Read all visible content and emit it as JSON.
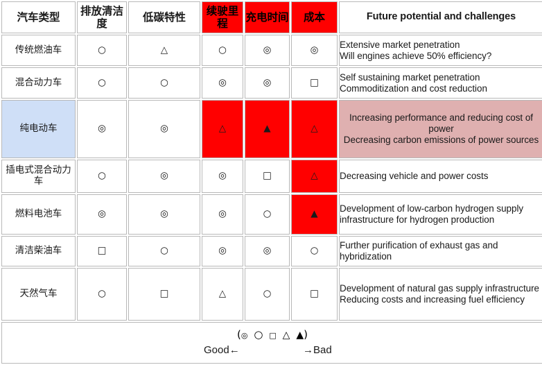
{
  "table": {
    "headers": [
      {
        "label": "汽车类型",
        "style": "blue",
        "cjk": true
      },
      {
        "label": "排放清洁度",
        "style": "blue",
        "cjk": true
      },
      {
        "label": "低碳特性",
        "style": "blue",
        "cjk": true
      },
      {
        "label": "续驶里程",
        "style": "red",
        "cjk": true
      },
      {
        "label": "充电时间",
        "style": "red",
        "cjk": true
      },
      {
        "label": "成本",
        "style": "red",
        "cjk": true
      },
      {
        "label": "Future potential and challenges",
        "style": "blue",
        "cjk": false
      }
    ],
    "rows": [
      {
        "type": "传统燃油车",
        "type_highlight": false,
        "cells": [
          {
            "symbol": "○",
            "glyph": "circle",
            "red": false
          },
          {
            "symbol": "△",
            "glyph": "triangle",
            "red": false
          },
          {
            "symbol": "○",
            "glyph": "circle",
            "red": false
          },
          {
            "symbol": "◎",
            "glyph": "double-circle",
            "red": false
          },
          {
            "symbol": "◎",
            "glyph": "double-circle",
            "red": false
          }
        ],
        "notes": [
          "Extensive market penetration",
          "Will engines achieve 50% efficiency?"
        ],
        "notes_pink": false
      },
      {
        "type": "混合动力车",
        "type_highlight": false,
        "cells": [
          {
            "symbol": "○",
            "glyph": "circle",
            "red": false
          },
          {
            "symbol": "○",
            "glyph": "circle",
            "red": false
          },
          {
            "symbol": "◎",
            "glyph": "double-circle",
            "red": false
          },
          {
            "symbol": "◎",
            "glyph": "double-circle",
            "red": false
          },
          {
            "symbol": "□",
            "glyph": "square",
            "red": false
          }
        ],
        "notes": [
          "Self sustaining market penetration",
          "Commoditization and cost reduction"
        ],
        "notes_pink": false
      },
      {
        "type": "纯电动车",
        "type_highlight": true,
        "cells": [
          {
            "symbol": "◎",
            "glyph": "double-circle",
            "red": false
          },
          {
            "symbol": "◎",
            "glyph": "double-circle",
            "red": false
          },
          {
            "symbol": "△",
            "glyph": "triangle",
            "red": true
          },
          {
            "symbol": "▲",
            "glyph": "filled-triangle",
            "red": true
          },
          {
            "symbol": "△",
            "glyph": "triangle",
            "red": true
          }
        ],
        "notes": [
          "Increasing performance and reducing cost of power",
          "Decreasing carbon emissions of power sources"
        ],
        "notes_pink": true
      },
      {
        "type": "插电式混合动力车",
        "type_highlight": false,
        "cells": [
          {
            "symbol": "○",
            "glyph": "circle",
            "red": false
          },
          {
            "symbol": "◎",
            "glyph": "double-circle",
            "red": false
          },
          {
            "symbol": "◎",
            "glyph": "double-circle",
            "red": false
          },
          {
            "symbol": "□",
            "glyph": "square",
            "red": false
          },
          {
            "symbol": "△",
            "glyph": "triangle",
            "red": true
          }
        ],
        "notes": [
          "Decreasing vehicle and power costs"
        ],
        "notes_pink": false
      },
      {
        "type": "燃料电池车",
        "type_highlight": false,
        "cells": [
          {
            "symbol": "◎",
            "glyph": "double-circle",
            "red": false
          },
          {
            "symbol": "◎",
            "glyph": "double-circle",
            "red": false
          },
          {
            "symbol": "◎",
            "glyph": "double-circle",
            "red": false
          },
          {
            "symbol": "○",
            "glyph": "circle",
            "red": false
          },
          {
            "symbol": "▲",
            "glyph": "filled-triangle",
            "red": true
          }
        ],
        "notes": [
          "Development of low-carbon hydrogen supply infrastructure for hydrogen production"
        ],
        "notes_pink": false
      },
      {
        "type": "清洁柴油车",
        "type_highlight": false,
        "cells": [
          {
            "symbol": "□",
            "glyph": "square",
            "red": false
          },
          {
            "symbol": "○",
            "glyph": "circle",
            "red": false
          },
          {
            "symbol": "◎",
            "glyph": "double-circle",
            "red": false
          },
          {
            "symbol": "◎",
            "glyph": "double-circle",
            "red": false
          },
          {
            "symbol": "○",
            "glyph": "circle",
            "red": false
          }
        ],
        "notes": [
          "Further purification of exhaust gas and hybridization"
        ],
        "notes_pink": false
      },
      {
        "type": "天然气车",
        "type_highlight": false,
        "cells": [
          {
            "symbol": "○",
            "glyph": "circle",
            "red": false
          },
          {
            "symbol": "□",
            "glyph": "square",
            "red": false
          },
          {
            "symbol": "△",
            "glyph": "triangle",
            "red": false
          },
          {
            "symbol": "○",
            "glyph": "circle",
            "red": false
          },
          {
            "symbol": "□",
            "glyph": "square",
            "red": false
          }
        ],
        "notes": [
          "Development of natural gas supply infrastructure",
          "Reducing costs and increasing fuel efficiency"
        ],
        "notes_pink": false
      }
    ]
  },
  "legend": {
    "open_paren": "(",
    "symbols": [
      "◎",
      "○",
      "□",
      "△",
      "▲"
    ],
    "close_paren": ")",
    "good_label": "Good←",
    "bad_label": "→Bad"
  },
  "colors": {
    "header_blue": "#d6e2f5",
    "header_red": "#ff0000",
    "row_highlight_pink": "#dfb0b0",
    "row_highlight_blue": "#cfdff7",
    "border": "#b8b8b8"
  }
}
